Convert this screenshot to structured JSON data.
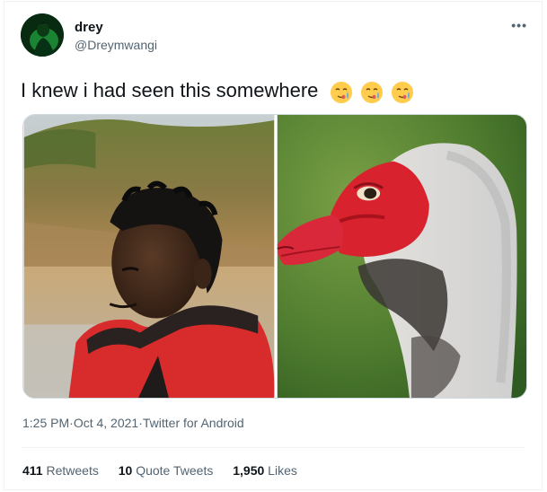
{
  "author": {
    "display_name": "drey",
    "handle": "@Dreymwangi",
    "avatar_icon": "avatar-image"
  },
  "menu_icon": "more-icon",
  "tweet": {
    "text": "I knew i had seen this somewhere",
    "emojis": [
      "face-holding-back-tears-emoji",
      "face-holding-back-tears-emoji",
      "face-holding-back-tears-emoji"
    ]
  },
  "media": {
    "left_image": "photo-man-red-jacket",
    "right_image": "photo-muscovy-duck"
  },
  "meta": {
    "time": "1:25 PM",
    "sep1": " · ",
    "date": "Oct 4, 2021",
    "sep2": " · ",
    "source": "Twitter for Android"
  },
  "stats": {
    "retweets_count": "411",
    "retweets_label": "Retweets",
    "quotes_count": "10",
    "quotes_label": "Quote Tweets",
    "likes_count": "1,950",
    "likes_label": "Likes"
  },
  "colors": {
    "text_primary": "#0f1419",
    "text_secondary": "#536471",
    "border": "#eff3f4",
    "emoji_yellow": "#ffcc4d",
    "tear_blue": "#5dadec"
  }
}
